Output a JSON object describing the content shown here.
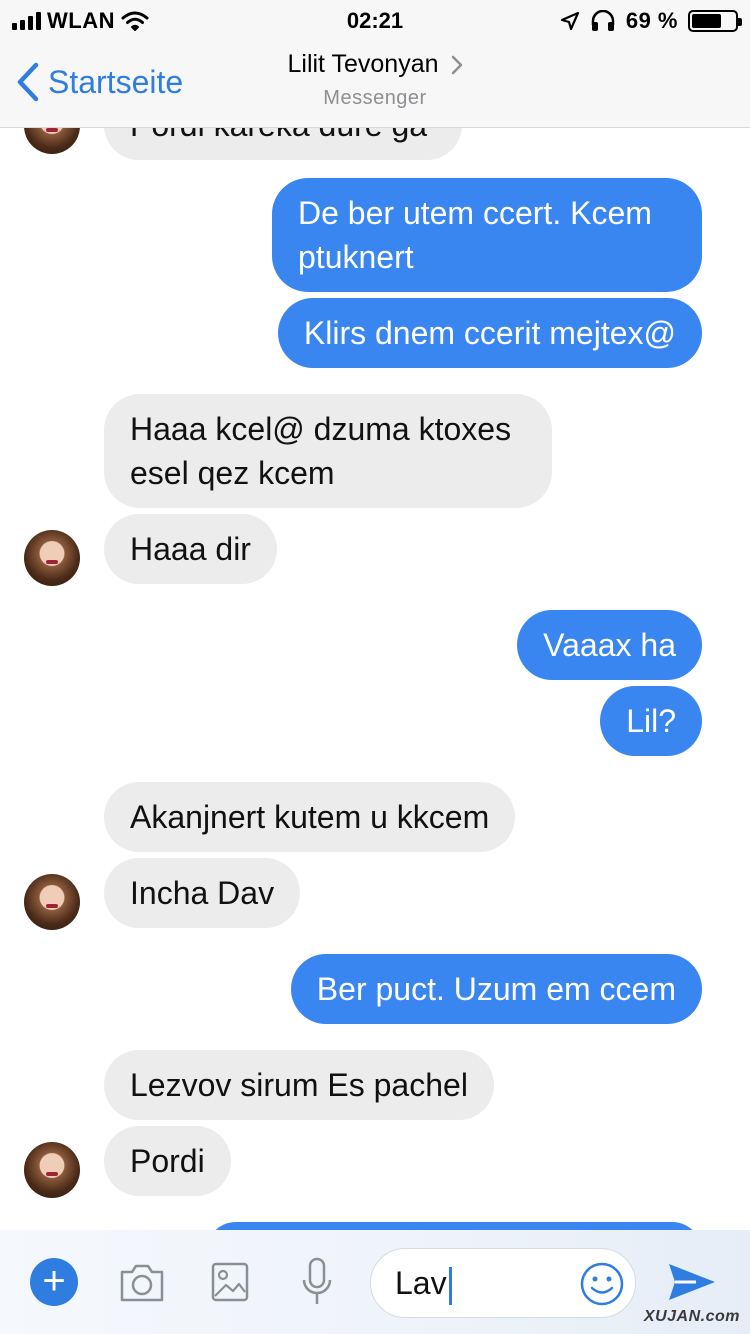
{
  "status_bar": {
    "carrier": "WLAN",
    "time": "02:21",
    "battery_percent": "69 %",
    "battery_level": 0.69
  },
  "nav": {
    "back_label": "Startseite",
    "contact_name": "Lilit Tevonyan",
    "subtitle": "Messenger"
  },
  "messages": [
    {
      "direction": "in",
      "text": "Pordi kareka dure ga"
    },
    {
      "direction": "out",
      "text": "De ber utem ccert. Kcem ptuknert"
    },
    {
      "direction": "out",
      "text": "Klirs dnem ccerit mejtex@"
    },
    {
      "direction": "in",
      "text": "Haaa kcel@ dzuma ktoxes esel qez kcem"
    },
    {
      "direction": "in",
      "text": "Haaa dir"
    },
    {
      "direction": "out",
      "text": "Vaaax ha"
    },
    {
      "direction": "out",
      "text": "Lil?"
    },
    {
      "direction": "in",
      "text": "Akanjnert kutem u kkcem"
    },
    {
      "direction": "in",
      "text": "Incha Dav"
    },
    {
      "direction": "out",
      "text": "Ber puct. Uzum em ccem"
    },
    {
      "direction": "in",
      "text": "Lezvov sirum Es pachel"
    },
    {
      "direction": "in",
      "text": "Pordi"
    }
  ],
  "composer": {
    "input_value": "Lav",
    "icons": [
      "plus-icon",
      "camera-icon",
      "image-icon",
      "microphone-icon",
      "emoji-icon",
      "send-icon"
    ]
  },
  "watermark": "XUJAN.com",
  "colors": {
    "accent": "#2f7de1",
    "outgoing_bubble": "#3a86f0",
    "incoming_bubble": "#ececec"
  }
}
